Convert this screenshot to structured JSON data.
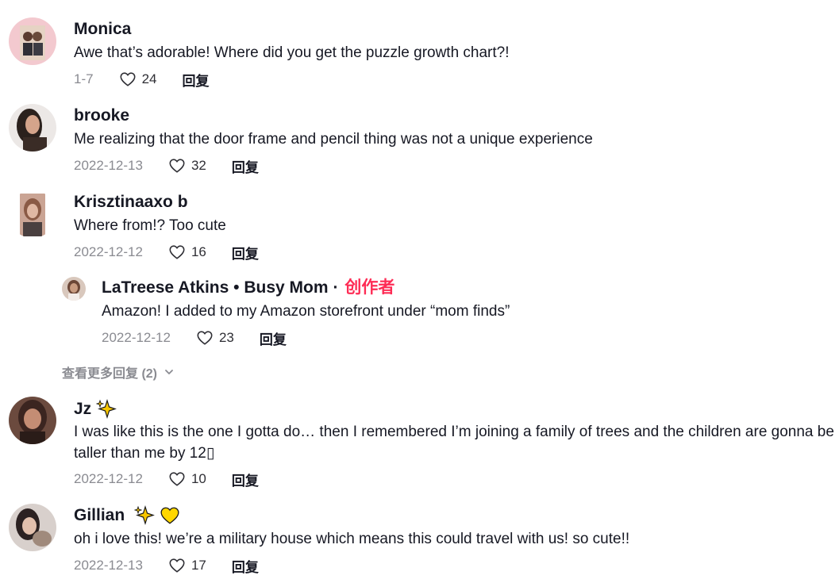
{
  "comments": [
    {
      "user": "Monica",
      "text": "Awe that’s adorable! Where did you get the puzzle growth chart?!",
      "date": "1-7",
      "likes": "24",
      "reply": "回复"
    },
    {
      "user": "brooke",
      "text": "Me realizing that the door frame and pencil thing was not a unique experience",
      "date": "2022-12-13",
      "likes": "32",
      "reply": "回复"
    },
    {
      "user": "Krisztinaaxo b",
      "text": "Where from!? Too cute",
      "date": "2022-12-12",
      "likes": "16",
      "reply": "回复"
    },
    {
      "user": "Jz",
      "text": "I was like this is the one I gotta do… then I remembered I’m joining a family of trees and the children are gonna be taller than me by 12▯",
      "date": "2022-12-12",
      "likes": "10",
      "reply": "回复"
    },
    {
      "user": "Gillian",
      "text": "oh i love this! we’re a military house which means this could travel with us! so cute!!",
      "date": "2022-12-13",
      "likes": "17",
      "reply": "回复"
    }
  ],
  "reply_thread": {
    "user": "LaTreese Atkins • Busy Mom",
    "separator": "·",
    "creator_label": "创作者",
    "text": "Amazon! I added to my Amazon storefront under “mom finds”",
    "date": "2022-12-12",
    "likes": "23",
    "reply": "回复"
  },
  "view_more": "查看更多回复 (2)",
  "icons": {
    "like": "heart-outline-icon",
    "expand": "chevron-down-icon",
    "sparkle": "sparkles-emoji",
    "heart_yellow": "yellow-heart-emoji"
  },
  "colors": {
    "creator": "#fe2c55",
    "meta": "#8a8b91",
    "text": "#161823"
  }
}
